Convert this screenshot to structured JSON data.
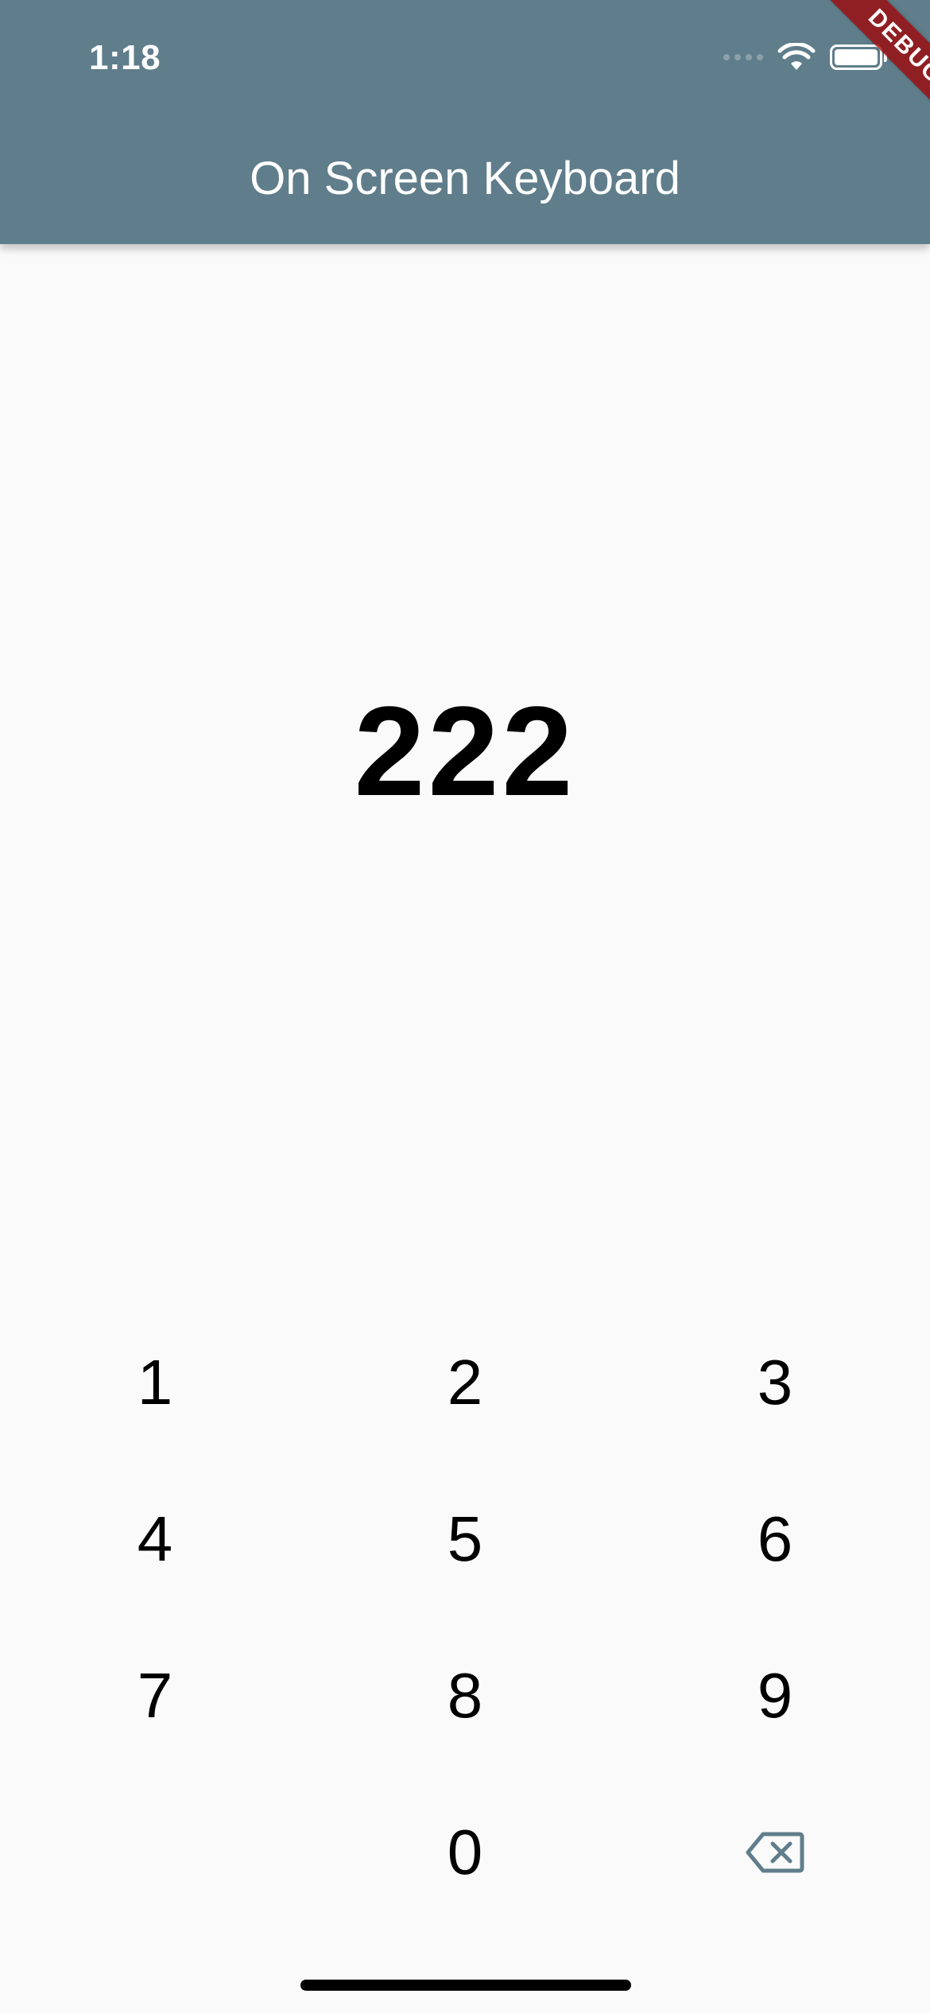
{
  "status_bar": {
    "time": "1:18"
  },
  "app_bar": {
    "title": "On Screen Keyboard",
    "color": "#607d8b"
  },
  "debug_banner": {
    "label": "DEBUG"
  },
  "display": {
    "value": "222"
  },
  "keypad": {
    "rows": [
      [
        "1",
        "2",
        "3"
      ],
      [
        "4",
        "5",
        "6"
      ],
      [
        "7",
        "8",
        "9"
      ],
      [
        "",
        "0",
        "backspace-icon"
      ]
    ]
  }
}
